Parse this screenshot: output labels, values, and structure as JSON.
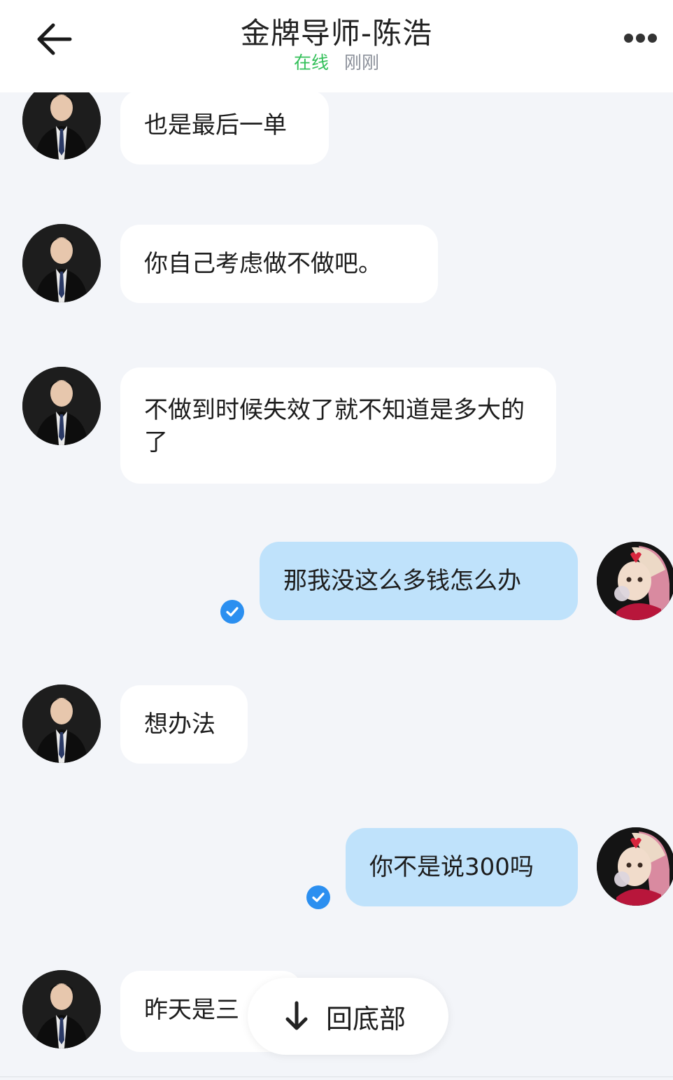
{
  "header": {
    "title": "金牌导师-陈浩",
    "status": "在线",
    "last_seen": "刚刚"
  },
  "messages": [
    {
      "sender": "mentor",
      "text": "也是最后一单"
    },
    {
      "sender": "mentor",
      "text": "你自己考虑做不做吧。"
    },
    {
      "sender": "mentor",
      "text": "不做到时候失效了就不知道是多大的了"
    },
    {
      "sender": "user",
      "text": "那我没这么多钱怎么办",
      "read": true
    },
    {
      "sender": "mentor",
      "text": "想办法"
    },
    {
      "sender": "user",
      "text": "你不是说300吗",
      "read": true
    },
    {
      "sender": "mentor",
      "text": "昨天是三"
    }
  ],
  "jump_to_bottom": {
    "label": "回底部"
  },
  "colors": {
    "background": "#f3f5f9",
    "incoming_bubble": "#ffffff",
    "outgoing_bubble": "#bfe2fb",
    "online": "#34c05a",
    "read_check": "#2b8ff0"
  },
  "icons": {
    "back": "arrow-left-icon",
    "more": "more-dots-icon",
    "read": "check-circle-icon",
    "jump": "arrow-down-icon"
  }
}
